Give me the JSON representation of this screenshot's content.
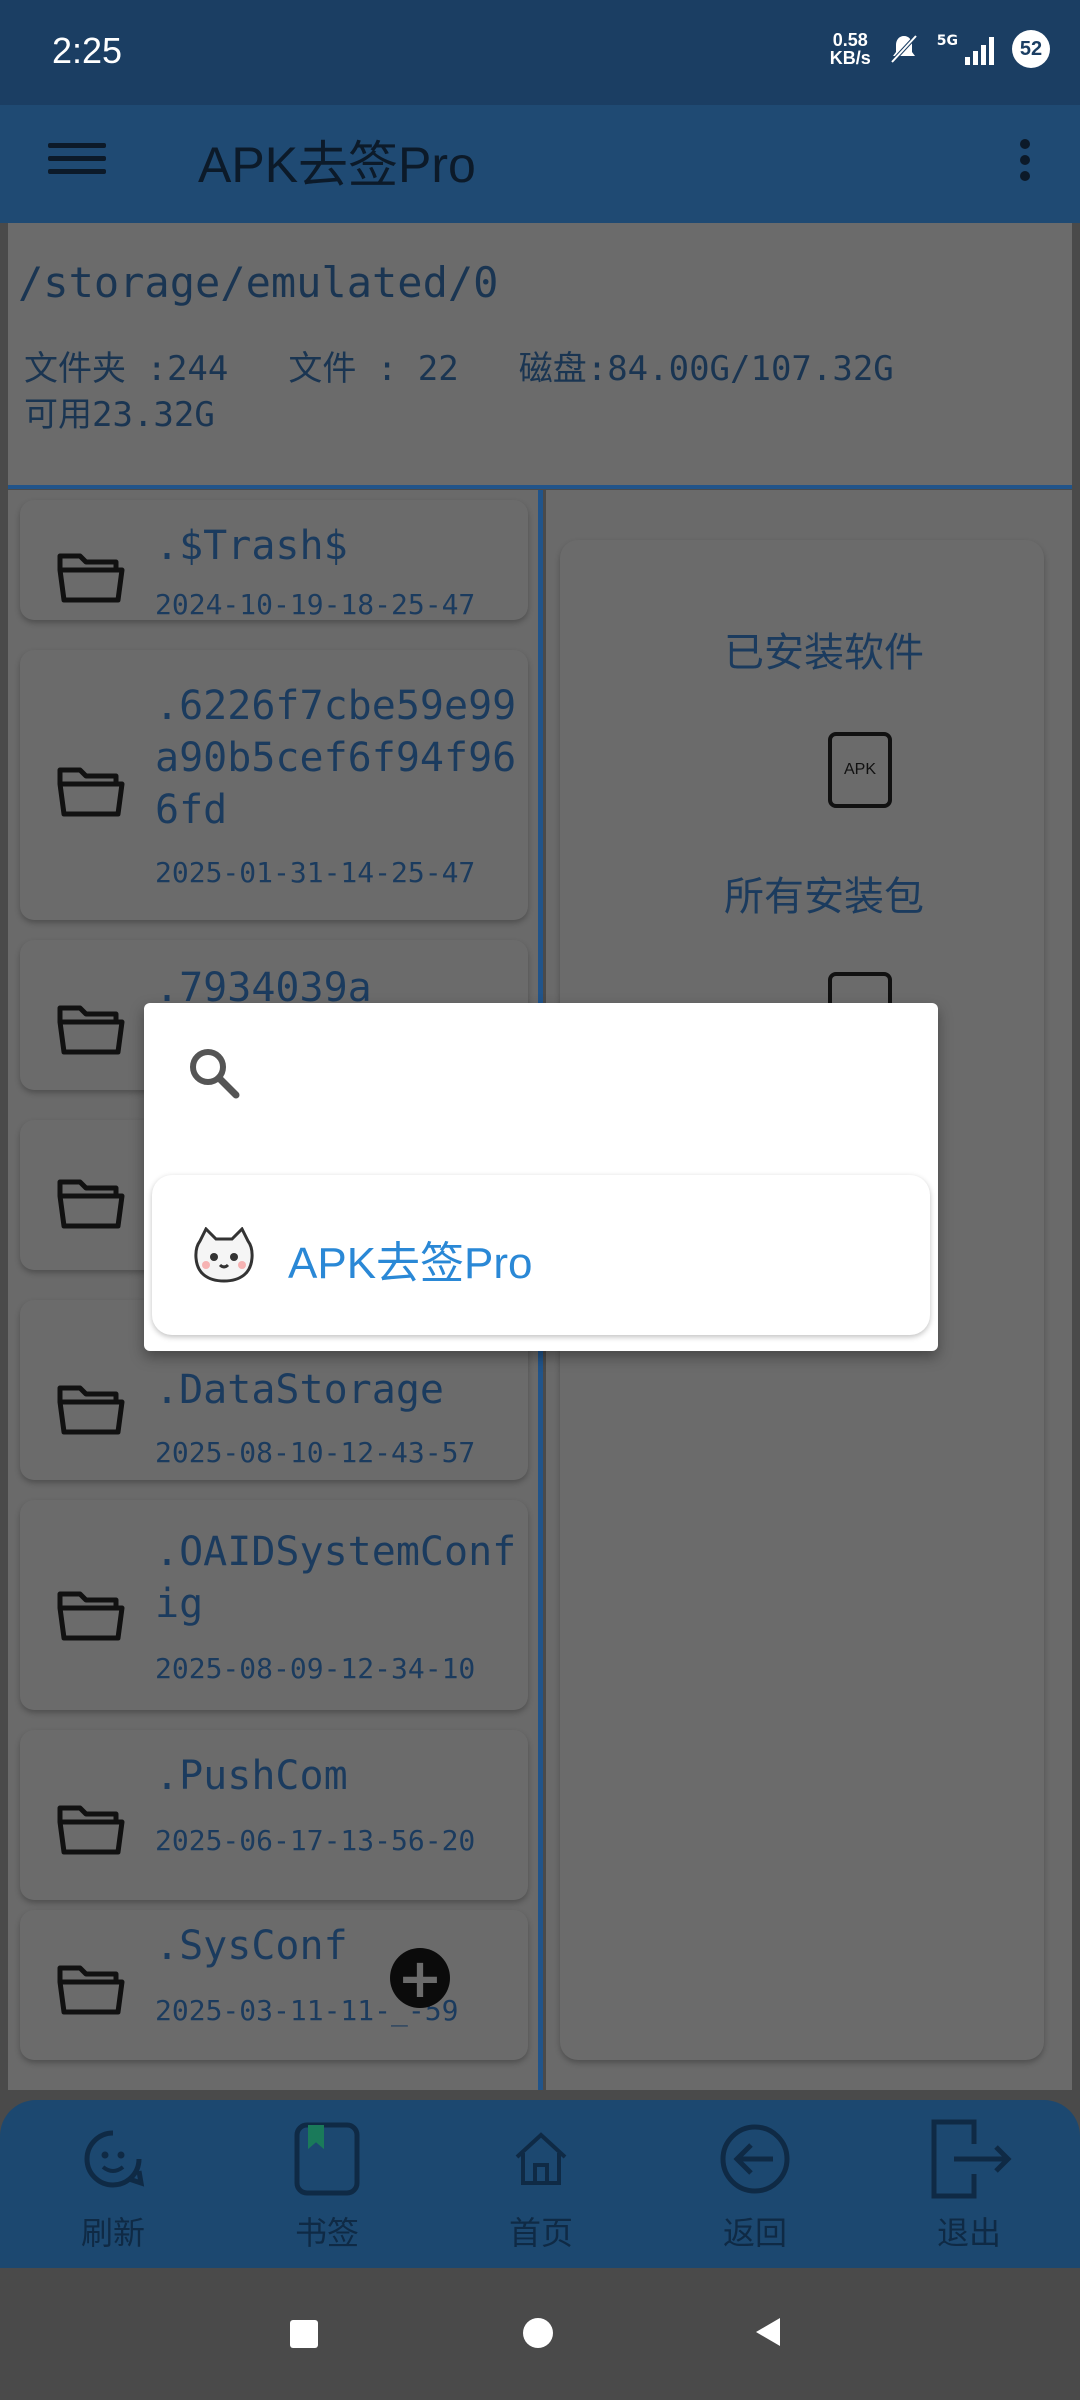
{
  "status": {
    "time": "2:25",
    "speed_top": "0.58",
    "speed_bottom": "KB/s",
    "network": "5G",
    "battery": "52"
  },
  "app": {
    "title": "APK去签Pro"
  },
  "storage": {
    "path": "/storage/emulated/0",
    "folders": "文件夹 :244",
    "files": "文件 : 22",
    "disk": "磁盘:84.00G/107.32G",
    "available": "可用23.32G"
  },
  "files": [
    {
      "name": ".$Trash$",
      "date": "2024-10-19-18-25-47"
    },
    {
      "name": ".6226f7cbe59e99a90b5cef6f94f966fd",
      "date": "2025-01-31-14-25-47"
    },
    {
      "name": ".7934039a",
      "date": ""
    },
    {
      "name": "",
      "date": ""
    },
    {
      "name": ".DataStorage",
      "date": "2025-08-10-12-43-57"
    },
    {
      "name": ".OAIDSystemConfig",
      "date": "2025-08-09-12-34-10"
    },
    {
      "name": ".PushCom",
      "date": "2025-06-17-13-56-20"
    },
    {
      "name": ".SysConf",
      "date": "2025-03-11-11-_-59"
    }
  ],
  "right_panel": {
    "installed": "已安装软件",
    "packages": "所有安装包",
    "apk_icon": "APK"
  },
  "popup": {
    "result_label": "APK去签Pro"
  },
  "bottom_nav": [
    {
      "label": "刷新",
      "icon": "refresh-face-icon"
    },
    {
      "label": "书签",
      "icon": "bookmark-icon"
    },
    {
      "label": "首页",
      "icon": "home-icon"
    },
    {
      "label": "返回",
      "icon": "back-arrow-icon"
    },
    {
      "label": "退出",
      "icon": "exit-icon"
    }
  ]
}
